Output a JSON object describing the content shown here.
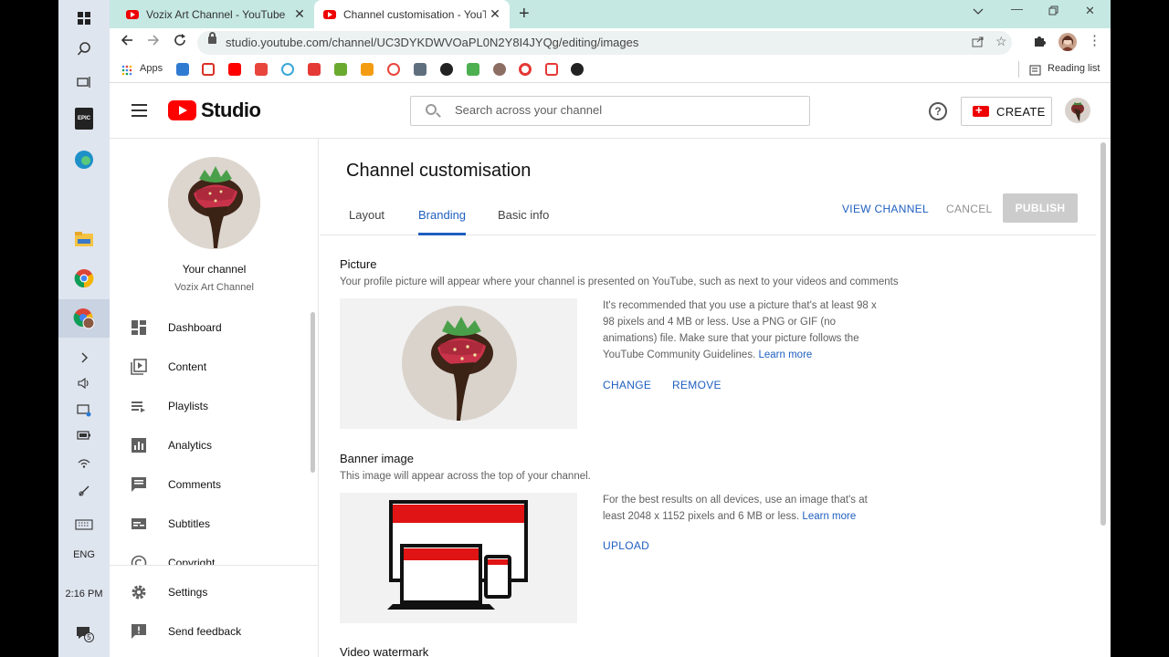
{
  "browser": {
    "tabs": [
      {
        "title": "Vozix Art Channel - YouTube",
        "active": false
      },
      {
        "title": "Channel customisation - YouTube Studio",
        "active": true
      }
    ],
    "url": "studio.youtube.com/channel/UC3DYKDWVOaPL0N2Y8I4JYQg/editing/images",
    "bookmarks": {
      "apps_label": "Apps",
      "reading_list": "Reading list"
    }
  },
  "taskbar": {
    "lang": "ENG",
    "time": "2:16 PM",
    "notification_count": "5"
  },
  "header": {
    "logo_text": "Studio",
    "search_placeholder": "Search across your channel",
    "create_label": "CREATE"
  },
  "sidebar": {
    "your_channel": "Your channel",
    "channel_name": "Vozix Art Channel",
    "items": [
      {
        "label": "Dashboard",
        "icon": "dashboard-icon"
      },
      {
        "label": "Content",
        "icon": "content-icon"
      },
      {
        "label": "Playlists",
        "icon": "playlists-icon"
      },
      {
        "label": "Analytics",
        "icon": "analytics-icon"
      },
      {
        "label": "Comments",
        "icon": "comments-icon"
      },
      {
        "label": "Subtitles",
        "icon": "subtitles-icon"
      },
      {
        "label": "Copyright",
        "icon": "copyright-icon"
      }
    ],
    "bottom": [
      {
        "label": "Settings",
        "icon": "gear-icon"
      },
      {
        "label": "Send feedback",
        "icon": "feedback-icon"
      }
    ]
  },
  "main": {
    "title": "Channel customisation",
    "tabs": [
      "Layout",
      "Branding",
      "Basic info"
    ],
    "selected_tab": "Branding",
    "view_channel": "VIEW CHANNEL",
    "cancel": "CANCEL",
    "publish": "PUBLISH",
    "picture": {
      "title": "Picture",
      "desc": "Your profile picture will appear where your channel is presented on YouTube, such as next to your videos and comments",
      "info": "It's recommended that you use a picture that's at least 98 x 98 pixels and 4 MB or less. Use a PNG or GIF (no animations) file. Make sure that your picture follows the YouTube Community Guidelines.",
      "learn_more": "Learn more",
      "change": "CHANGE",
      "remove": "REMOVE"
    },
    "banner": {
      "title": "Banner image",
      "desc": "This image will appear across the top of your channel.",
      "info": "For the best results on all devices, use an image that's at least 2048 x 1152 pixels and 6 MB or less.",
      "learn_more": "Learn more",
      "upload": "UPLOAD"
    },
    "watermark": {
      "title": "Video watermark"
    }
  },
  "colors": {
    "accent": "#1f5fbf",
    "youtube_red": "#ff0000",
    "tab_strip": "#c5e8e3"
  }
}
